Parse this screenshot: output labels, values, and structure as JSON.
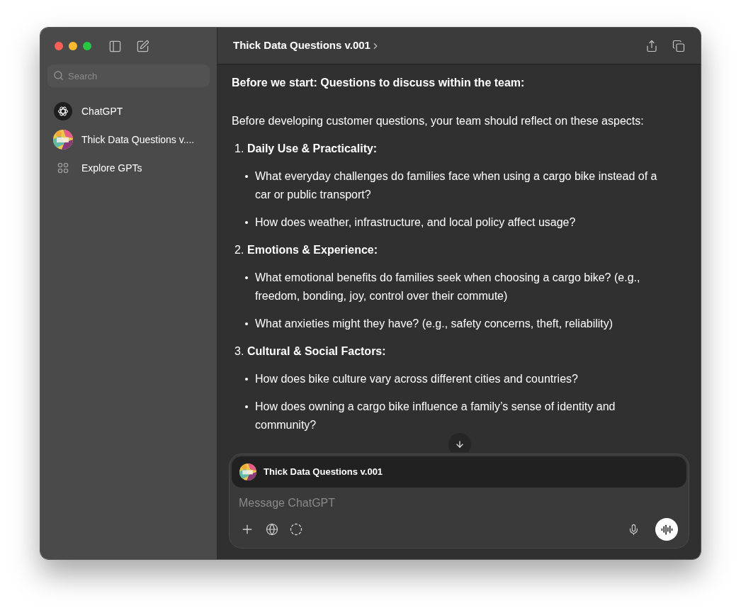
{
  "sidebar": {
    "search": {
      "placeholder": "Search"
    },
    "items": [
      {
        "kind": "chatgpt",
        "label": "ChatGPT"
      },
      {
        "kind": "gpt",
        "label": "Thick Data Questions v...."
      },
      {
        "kind": "explore",
        "label": "Explore GPTs"
      }
    ]
  },
  "header": {
    "title": "Thick Data Questions v.001"
  },
  "message": {
    "heading": "Before we start: Questions to discuss within the team:",
    "intro": "Before developing customer questions, your team should reflect on these aspects:",
    "sections": [
      {
        "number": "1.",
        "title": "Daily Use & Practicality:",
        "bullets": [
          "What everyday challenges do families face when using a cargo bike instead of a car or public transport?",
          "How does weather, infrastructure, and local policy affect usage?"
        ]
      },
      {
        "number": "2.",
        "title": "Emotions & Experience:",
        "bullets": [
          "What emotional benefits do families seek when choosing a cargo bike? (e.g., freedom, bonding, joy, control over their commute)",
          "What anxieties might they have? (e.g., safety concerns, theft, reliability)"
        ]
      },
      {
        "number": "3.",
        "title": "Cultural & Social Factors:",
        "bullets": [
          "How does bike culture vary across different cities and countries?",
          "How does owning a cargo bike influence a family’s sense of identity and community?"
        ]
      }
    ]
  },
  "composer": {
    "gpt_name": "Thick Data Questions v.001",
    "placeholder": "Message ChatGPT"
  }
}
